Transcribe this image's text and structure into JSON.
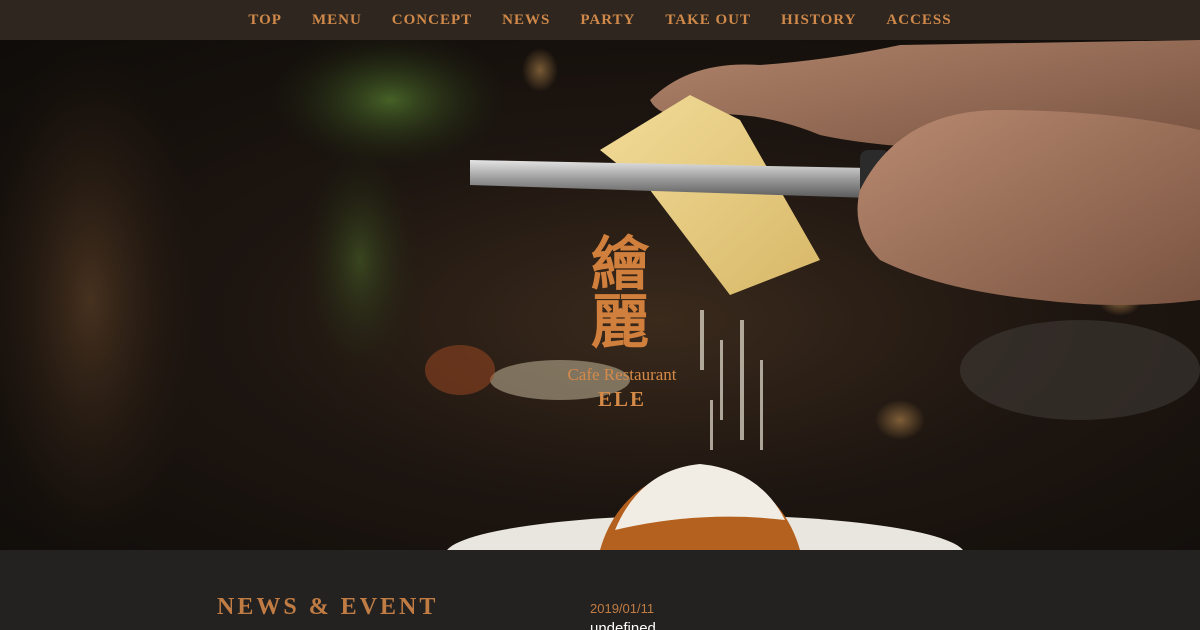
{
  "nav": {
    "items": [
      {
        "label": "TOP"
      },
      {
        "label": "MENU"
      },
      {
        "label": "CONCEPT"
      },
      {
        "label": "NEWS"
      },
      {
        "label": "PARTY"
      },
      {
        "label": "TAKE OUT"
      },
      {
        "label": "HISTORY"
      },
      {
        "label": "ACCESS"
      }
    ]
  },
  "hero": {
    "logo_kanji": "繪麗",
    "subtitle": "Cafe Restaurant",
    "name": "ELE"
  },
  "news": {
    "heading": "NEWS & EVENT",
    "date": "2019/01/11",
    "title": "undefined"
  },
  "colors": {
    "accent": "#d0894a",
    "nav_bg": "#2f271f",
    "footer_bg": "#232221"
  }
}
